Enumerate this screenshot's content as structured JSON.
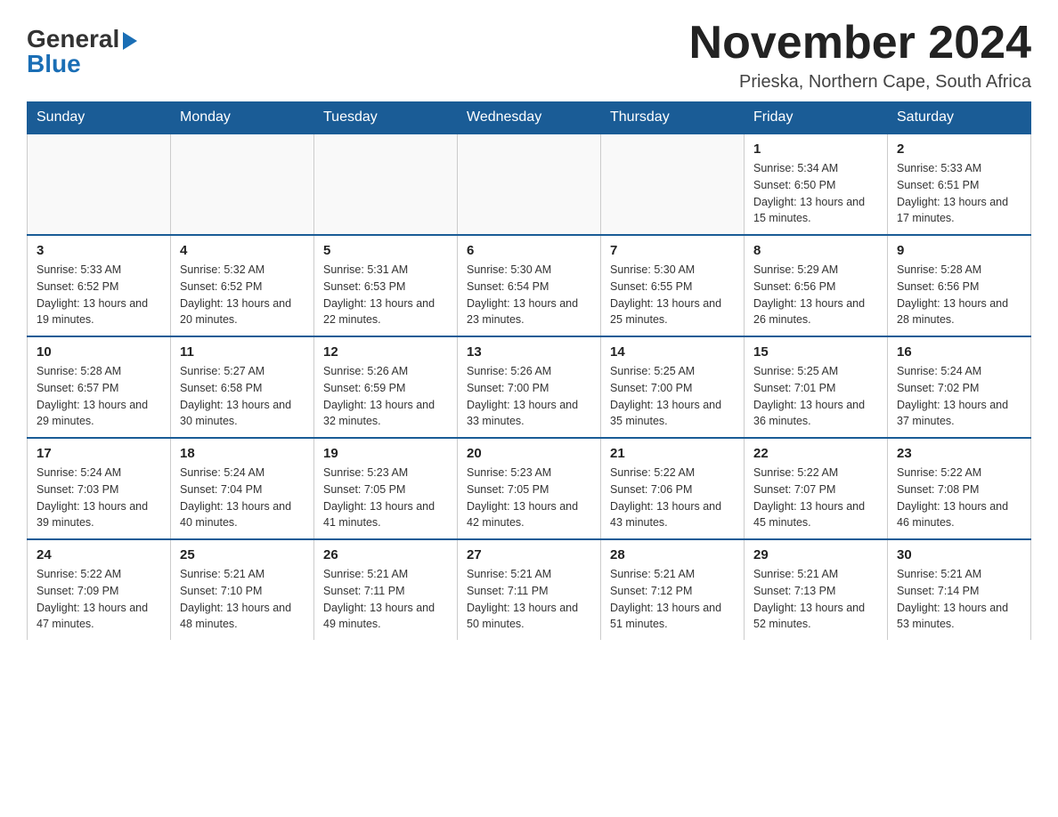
{
  "logo": {
    "general": "General",
    "blue": "Blue"
  },
  "title": "November 2024",
  "location": "Prieska, Northern Cape, South Africa",
  "days_of_week": [
    "Sunday",
    "Monday",
    "Tuesday",
    "Wednesday",
    "Thursday",
    "Friday",
    "Saturday"
  ],
  "weeks": [
    [
      {
        "day": "",
        "info": ""
      },
      {
        "day": "",
        "info": ""
      },
      {
        "day": "",
        "info": ""
      },
      {
        "day": "",
        "info": ""
      },
      {
        "day": "",
        "info": ""
      },
      {
        "day": "1",
        "info": "Sunrise: 5:34 AM\nSunset: 6:50 PM\nDaylight: 13 hours and 15 minutes."
      },
      {
        "day": "2",
        "info": "Sunrise: 5:33 AM\nSunset: 6:51 PM\nDaylight: 13 hours and 17 minutes."
      }
    ],
    [
      {
        "day": "3",
        "info": "Sunrise: 5:33 AM\nSunset: 6:52 PM\nDaylight: 13 hours and 19 minutes."
      },
      {
        "day": "4",
        "info": "Sunrise: 5:32 AM\nSunset: 6:52 PM\nDaylight: 13 hours and 20 minutes."
      },
      {
        "day": "5",
        "info": "Sunrise: 5:31 AM\nSunset: 6:53 PM\nDaylight: 13 hours and 22 minutes."
      },
      {
        "day": "6",
        "info": "Sunrise: 5:30 AM\nSunset: 6:54 PM\nDaylight: 13 hours and 23 minutes."
      },
      {
        "day": "7",
        "info": "Sunrise: 5:30 AM\nSunset: 6:55 PM\nDaylight: 13 hours and 25 minutes."
      },
      {
        "day": "8",
        "info": "Sunrise: 5:29 AM\nSunset: 6:56 PM\nDaylight: 13 hours and 26 minutes."
      },
      {
        "day": "9",
        "info": "Sunrise: 5:28 AM\nSunset: 6:56 PM\nDaylight: 13 hours and 28 minutes."
      }
    ],
    [
      {
        "day": "10",
        "info": "Sunrise: 5:28 AM\nSunset: 6:57 PM\nDaylight: 13 hours and 29 minutes."
      },
      {
        "day": "11",
        "info": "Sunrise: 5:27 AM\nSunset: 6:58 PM\nDaylight: 13 hours and 30 minutes."
      },
      {
        "day": "12",
        "info": "Sunrise: 5:26 AM\nSunset: 6:59 PM\nDaylight: 13 hours and 32 minutes."
      },
      {
        "day": "13",
        "info": "Sunrise: 5:26 AM\nSunset: 7:00 PM\nDaylight: 13 hours and 33 minutes."
      },
      {
        "day": "14",
        "info": "Sunrise: 5:25 AM\nSunset: 7:00 PM\nDaylight: 13 hours and 35 minutes."
      },
      {
        "day": "15",
        "info": "Sunrise: 5:25 AM\nSunset: 7:01 PM\nDaylight: 13 hours and 36 minutes."
      },
      {
        "day": "16",
        "info": "Sunrise: 5:24 AM\nSunset: 7:02 PM\nDaylight: 13 hours and 37 minutes."
      }
    ],
    [
      {
        "day": "17",
        "info": "Sunrise: 5:24 AM\nSunset: 7:03 PM\nDaylight: 13 hours and 39 minutes."
      },
      {
        "day": "18",
        "info": "Sunrise: 5:24 AM\nSunset: 7:04 PM\nDaylight: 13 hours and 40 minutes."
      },
      {
        "day": "19",
        "info": "Sunrise: 5:23 AM\nSunset: 7:05 PM\nDaylight: 13 hours and 41 minutes."
      },
      {
        "day": "20",
        "info": "Sunrise: 5:23 AM\nSunset: 7:05 PM\nDaylight: 13 hours and 42 minutes."
      },
      {
        "day": "21",
        "info": "Sunrise: 5:22 AM\nSunset: 7:06 PM\nDaylight: 13 hours and 43 minutes."
      },
      {
        "day": "22",
        "info": "Sunrise: 5:22 AM\nSunset: 7:07 PM\nDaylight: 13 hours and 45 minutes."
      },
      {
        "day": "23",
        "info": "Sunrise: 5:22 AM\nSunset: 7:08 PM\nDaylight: 13 hours and 46 minutes."
      }
    ],
    [
      {
        "day": "24",
        "info": "Sunrise: 5:22 AM\nSunset: 7:09 PM\nDaylight: 13 hours and 47 minutes."
      },
      {
        "day": "25",
        "info": "Sunrise: 5:21 AM\nSunset: 7:10 PM\nDaylight: 13 hours and 48 minutes."
      },
      {
        "day": "26",
        "info": "Sunrise: 5:21 AM\nSunset: 7:11 PM\nDaylight: 13 hours and 49 minutes."
      },
      {
        "day": "27",
        "info": "Sunrise: 5:21 AM\nSunset: 7:11 PM\nDaylight: 13 hours and 50 minutes."
      },
      {
        "day": "28",
        "info": "Sunrise: 5:21 AM\nSunset: 7:12 PM\nDaylight: 13 hours and 51 minutes."
      },
      {
        "day": "29",
        "info": "Sunrise: 5:21 AM\nSunset: 7:13 PM\nDaylight: 13 hours and 52 minutes."
      },
      {
        "day": "30",
        "info": "Sunrise: 5:21 AM\nSunset: 7:14 PM\nDaylight: 13 hours and 53 minutes."
      }
    ]
  ]
}
